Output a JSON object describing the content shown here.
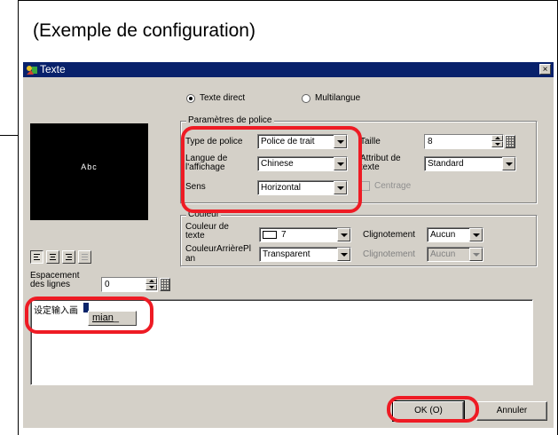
{
  "caption": "(Exemple de configuration)",
  "dialog": {
    "title": "Texte",
    "close_glyph": "×",
    "icons": {
      "app": "texte-app-icon",
      "close": "close-icon"
    },
    "mode": {
      "direct_label": "Texte direct",
      "multilang_label": "Multilangue",
      "selected": "direct"
    },
    "preview_text": "Abc",
    "font_group": {
      "legend": "Paramètres de police",
      "type_label": "Type de police",
      "type_value": "Police de trait",
      "lang_label": "Langue de l'affichage",
      "lang_value": "Chinese",
      "dir_label": "Sens",
      "dir_value": "Horizontal",
      "size_label": "Taille",
      "size_value": "8",
      "attr_label": "Attribut de texte",
      "attr_value": "Standard",
      "center_label": "Centrage"
    },
    "color_group": {
      "legend": "Couleur",
      "text_color_label": "Couleur de texte",
      "text_color_value": "7",
      "bg_color_label": "CouleurArrièrePlan",
      "bg_color_value": "Transparent",
      "blink1_label": "Clignotement",
      "blink1_value": "Aucun",
      "blink2_label": "Clignotement",
      "blink2_value": "Aucun"
    },
    "align_icons": [
      "align-left-icon",
      "align-center-icon",
      "align-right-icon",
      "align-justify-icon"
    ],
    "line_spacing_label": "Espacement des lignes",
    "line_spacing_value": "0",
    "text_area": {
      "content": "设定输入画",
      "ime_candidate": "mian_",
      "ime_candidate_underlined": "mian",
      "ime_candidate_rest": "_"
    },
    "ok_label": "OK (O)",
    "cancel_label": "Annuler"
  },
  "colors": {
    "titlebar": "#08216b",
    "dialog_bg": "#d4d0c8",
    "highlight": "#ee1b24",
    "preview_bg": "#000000"
  }
}
